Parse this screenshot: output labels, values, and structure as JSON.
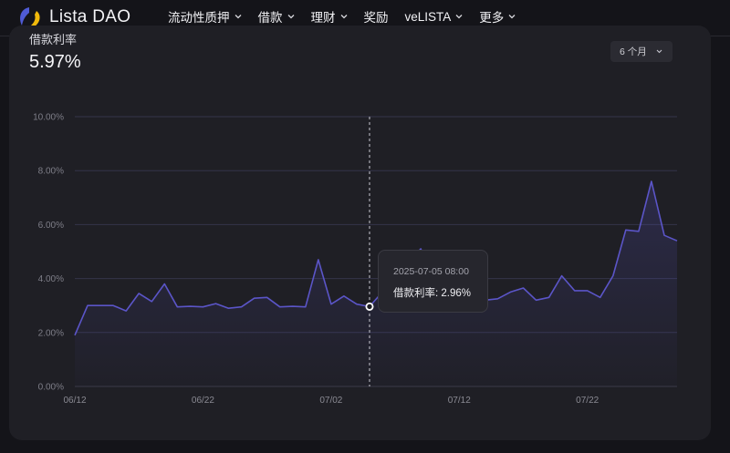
{
  "brand": {
    "name": "Lista DAO",
    "logo": "lista-logo"
  },
  "nav": {
    "items": [
      {
        "label": "流动性质押",
        "dropdown": true
      },
      {
        "label": "借款",
        "dropdown": true
      },
      {
        "label": "理财",
        "dropdown": true
      },
      {
        "label": "奖励",
        "dropdown": false
      },
      {
        "label": "veLISTA",
        "dropdown": true
      },
      {
        "label": "更多",
        "dropdown": true
      }
    ]
  },
  "card": {
    "title": "借款利率",
    "value": "5.97%",
    "period_label": "6 个月"
  },
  "tooltip": {
    "date": "2025-07-05 08:00",
    "label": "借款利率: 2.96%"
  },
  "colors": {
    "line": "#5b55c8",
    "grid": "#34344a",
    "background": "#1f1f25"
  },
  "chart_data": {
    "type": "area",
    "x_tick_labels": [
      "06/12",
      "06/22",
      "07/02",
      "07/12",
      "07/22"
    ],
    "y_tick_labels": [
      "0.00%",
      "2.00%",
      "4.00%",
      "6.00%",
      "8.00%",
      "10.00%"
    ],
    "ylim": [
      0,
      10
    ],
    "x_range": [
      "2025-06-12",
      "2025-07-29"
    ],
    "grid": true,
    "hover_date": "2025-07-05",
    "series": [
      {
        "x": [
          "2025-06-12",
          "2025-06-13",
          "2025-06-14",
          "2025-06-15",
          "2025-06-16",
          "2025-06-17",
          "2025-06-18",
          "2025-06-19",
          "2025-06-20",
          "2025-06-21",
          "2025-06-22",
          "2025-06-23",
          "2025-06-24",
          "2025-06-25",
          "2025-06-26",
          "2025-06-27",
          "2025-06-28",
          "2025-06-29",
          "2025-06-30",
          "2025-07-01",
          "2025-07-02",
          "2025-07-03",
          "2025-07-04",
          "2025-07-05",
          "2025-07-06",
          "2025-07-07",
          "2025-07-08",
          "2025-07-09",
          "2025-07-10",
          "2025-07-11",
          "2025-07-12",
          "2025-07-13",
          "2025-07-14",
          "2025-07-15",
          "2025-07-16",
          "2025-07-17",
          "2025-07-18",
          "2025-07-19",
          "2025-07-20",
          "2025-07-21",
          "2025-07-22",
          "2025-07-23",
          "2025-07-24",
          "2025-07-25",
          "2025-07-26",
          "2025-07-27",
          "2025-07-28",
          "2025-07-29"
        ],
        "values": [
          1.9,
          3.0,
          3.0,
          3.0,
          2.8,
          3.45,
          3.15,
          3.8,
          2.95,
          2.97,
          2.95,
          3.07,
          2.9,
          2.95,
          3.27,
          3.3,
          2.95,
          2.97,
          2.95,
          4.7,
          3.05,
          3.35,
          3.05,
          2.96,
          3.5,
          3.9,
          4.6,
          5.1,
          4.0,
          3.4,
          3.3,
          3.2,
          3.2,
          3.25,
          3.5,
          3.65,
          3.2,
          3.3,
          4.1,
          3.55,
          3.55,
          3.3,
          4.1,
          5.8,
          5.75,
          7.6,
          5.6,
          5.4
        ]
      }
    ]
  }
}
